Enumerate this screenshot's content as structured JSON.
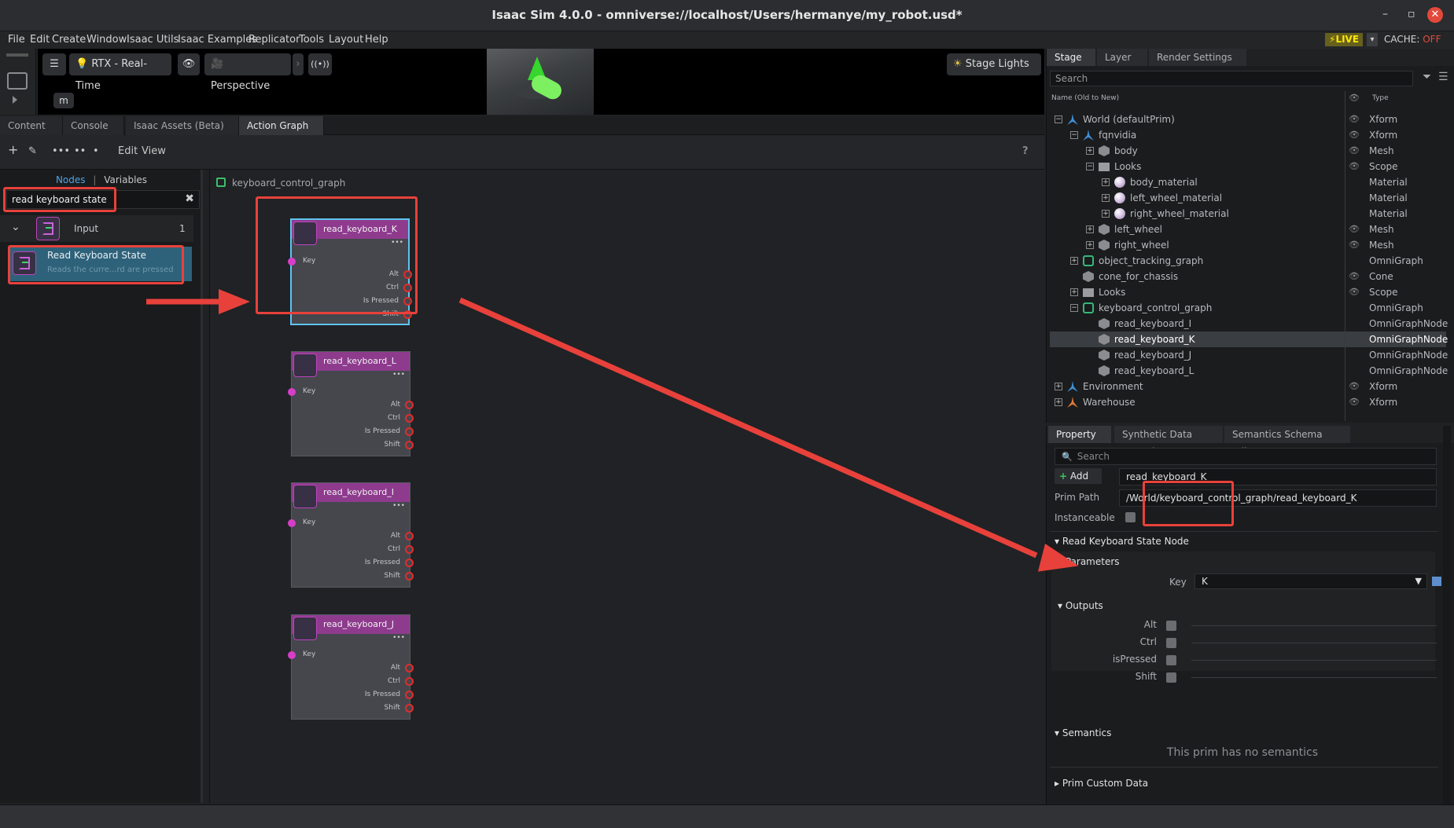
{
  "window": {
    "title": "Isaac Sim 4.0.0 - omniverse://localhost/Users/hermanye/my_robot.usd*"
  },
  "menu": [
    "File",
    "Edit",
    "Create",
    "Window",
    "Isaac Utils",
    "Isaac Examples",
    "Replicator",
    "Tools",
    "Layout",
    "Help"
  ],
  "status": {
    "live": "LIVE",
    "cache_label": "CACHE:",
    "cache_value": "OFF"
  },
  "viewport": {
    "rtx": "RTX - Real-Time",
    "camera": "Perspective",
    "signal": "((•))",
    "lights": "Stage Lights",
    "m_label": "m"
  },
  "tabs": [
    "Content",
    "Console",
    "Isaac Assets (Beta)",
    "Action Graph"
  ],
  "graph_toolbar": {
    "edit": "Edit",
    "view": "View",
    "help": "?"
  },
  "node_panel": {
    "nodes_tab": "Nodes",
    "sep": "|",
    "variables_tab": "Variables",
    "search_value": "read keyboard state",
    "group_label": "Input",
    "group_count": "1",
    "item_title": "Read Keyboard State",
    "item_desc": "Reads the curre...rd are pressed"
  },
  "graph": {
    "title": "keyboard_control_graph",
    "nodes": [
      {
        "title": "read_keyboard_K"
      },
      {
        "title": "read_keyboard_L"
      },
      {
        "title": "read_keyboard_I"
      },
      {
        "title": "read_keyboard_J"
      }
    ],
    "input_port": "Key",
    "output_ports": [
      "Alt",
      "Ctrl",
      "Is Pressed",
      "Shift"
    ],
    "more": "•••"
  },
  "stage": {
    "tabs": [
      "Stage",
      "Layer",
      "Render Settings"
    ],
    "search_placeholder": "Search",
    "col_name": "Name (Old to New)",
    "col_type": "Type",
    "rows": [
      {
        "name": "World (defaultPrim)",
        "type": "Xform"
      },
      {
        "name": "fqnvidia",
        "type": "Xform"
      },
      {
        "name": "body",
        "type": "Mesh"
      },
      {
        "name": "Looks",
        "type": "Scope"
      },
      {
        "name": "body_material",
        "type": "Material"
      },
      {
        "name": "left_wheel_material",
        "type": "Material"
      },
      {
        "name": "right_wheel_material",
        "type": "Material"
      },
      {
        "name": "left_wheel",
        "type": "Mesh"
      },
      {
        "name": "right_wheel",
        "type": "Mesh"
      },
      {
        "name": "object_tracking_graph",
        "type": "OmniGraph"
      },
      {
        "name": "cone_for_chassis",
        "type": "Cone"
      },
      {
        "name": "Looks",
        "type": "Scope"
      },
      {
        "name": "keyboard_control_graph",
        "type": "OmniGraph"
      },
      {
        "name": "read_keyboard_I",
        "type": "OmniGraphNode"
      },
      {
        "name": "read_keyboard_K",
        "type": "OmniGraphNode"
      },
      {
        "name": "read_keyboard_J",
        "type": "OmniGraphNode"
      },
      {
        "name": "read_keyboard_L",
        "type": "OmniGraphNode"
      },
      {
        "name": "Environment",
        "type": "Xform"
      },
      {
        "name": "Warehouse",
        "type": "Xform"
      }
    ]
  },
  "property": {
    "tabs": [
      "Property",
      "Synthetic Data Recorder",
      "Semantics Schema Editor"
    ],
    "search_placeholder": "Search",
    "add_label": "Add",
    "prim_name": "read_keyboard_K",
    "prim_path_label": "Prim Path",
    "prim_path": "/World/keyboard_control_graph/read_keyboard_K",
    "instanceable_label": "Instanceable",
    "node_section": "Read Keyboard State Node",
    "parameters": "Parameters",
    "key_label": "Key",
    "key_value": "K",
    "outputs": "Outputs",
    "output_labels": [
      "Alt",
      "Ctrl",
      "isPressed",
      "Shift"
    ],
    "semantics": "Semantics",
    "no_semantics": "This prim has no semantics",
    "custom_data": "Prim Custom Data"
  },
  "colors": {
    "accent": "#4aa5e6",
    "annotation": "#e8413b",
    "node_header": "#8e3b8e",
    "live": "#ffe600"
  }
}
